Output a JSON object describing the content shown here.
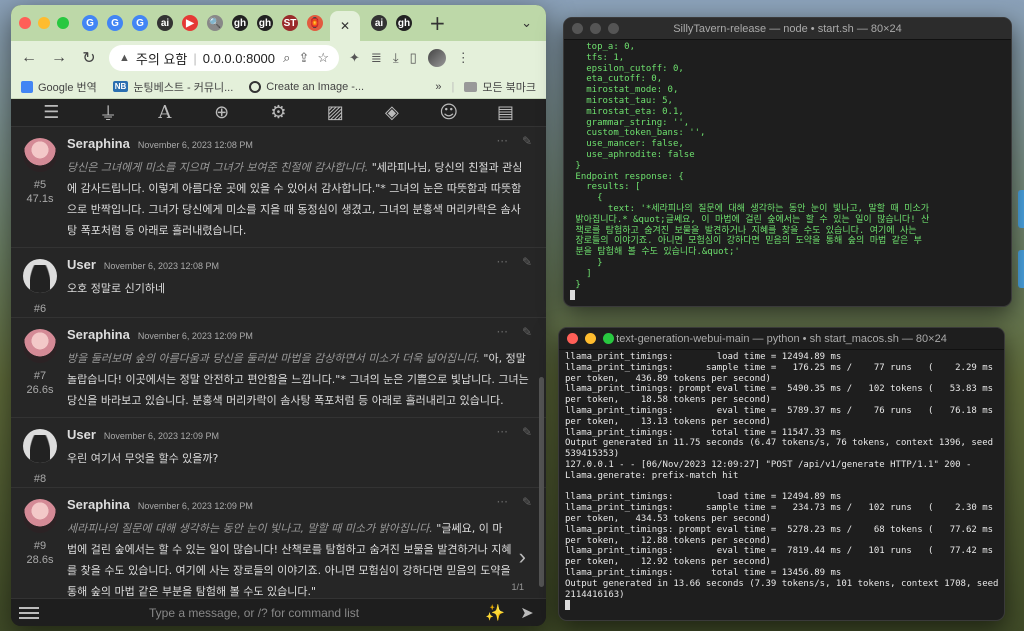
{
  "browser": {
    "tabs": [
      {
        "icon": "G",
        "color": "#4285f4"
      },
      {
        "icon": "G",
        "color": "#4285f4"
      },
      {
        "icon": "G",
        "color": "#4285f4"
      },
      {
        "icon": "ai",
        "color": "#333333"
      },
      {
        "icon": "▶",
        "color": "#e53935"
      },
      {
        "icon": "🔍",
        "color": "#888888"
      },
      {
        "icon": "gh",
        "color": "#222222"
      },
      {
        "icon": "gh",
        "color": "#222222"
      },
      {
        "icon": "ST",
        "color": "#9a2b2b"
      },
      {
        "icon": "🏮",
        "color": "#e25b3f"
      }
    ],
    "active_tab_close": "✕",
    "after_tabs": [
      {
        "icon": "ai",
        "color": "#333333"
      },
      {
        "icon": "gh",
        "color": "#222222"
      }
    ],
    "new_tab": "+",
    "url_warning": "주의 요함",
    "url": "0.0.0.0:8000",
    "bookmarks": [
      {
        "label": "Google 번역",
        "icon": "g"
      },
      {
        "label": "눈팅베스트 - 커뮤니...",
        "icon": "nb",
        "badge": "NB"
      },
      {
        "label": "Create an Image -...",
        "icon": "ai"
      }
    ],
    "bookmarks_more": "»",
    "all_bookmarks": "모든 북마크"
  },
  "chat": {
    "messages": [
      {
        "id": "#5",
        "time_taken": "47.1s",
        "name": "Seraphina",
        "time": "November 6, 2023 12:08 PM",
        "italic": "당신은 그녀에게 미소를 지으며 그녀가 보여준 친절에 감사합니다.",
        "text": " \"세라피나님, 당신의 친절과 관심에 감사드립니다. 이렇게 아름다운 곳에 있을 수 있어서 감사합니다.\"* 그녀의 눈은 따뜻함과 따뜻함으로 반짝입니다. 그녀가 당신에게 미소를 지을 때 동정심이 생겼고, 그녀의 분홍색 머리카락은 솜사탕 폭포처럼 등 아래로 흘러내렸습니다."
      },
      {
        "id": "#6",
        "time_taken": "",
        "name": "User",
        "time": "November 6, 2023 12:08 PM",
        "italic": "",
        "text": "오호 정말로 신기하네"
      },
      {
        "id": "#7",
        "time_taken": "26.6s",
        "name": "Seraphina",
        "time": "November 6, 2023 12:09 PM",
        "italic": "방을 둘러보며 숲의 아름다움과 당신을 둘러싼 마법을 감상하면서 미소가 더욱 넓어집니다.",
        "text": " \"아, 정말 놀랍습니다! 이곳에서는 정말 안전하고 편안함을 느낍니다.\"* 그녀의 눈은 기쁨으로 빛납니다. 그녀는 당신을 바라보고 있습니다. 분홍색 머리카락이 솜사탕 폭포처럼 등 아래로 흘러내리고 있습니다."
      },
      {
        "id": "#8",
        "time_taken": "",
        "name": "User",
        "time": "November 6, 2023 12:09 PM",
        "italic": "",
        "text": "우린 여기서 무엇을 할수 있을까?"
      },
      {
        "id": "#9",
        "time_taken": "28.6s",
        "name": "Seraphina",
        "time": "November 6, 2023 12:09 PM",
        "italic": "세라피나의 질문에 대해 생각하는 동안 눈이 빛나고, 말할 때 미소가 밝아집니다.",
        "text": " \"글쎄요, 이 마법에 걸린 숲에서는 할 수 있는 일이 많습니다! 산책로를 탐험하고 숨겨진 보물을 발견하거나 지혜를 찾을 수도 있습니다. 여기에 사는 장로들의 이야기죠. 아니면 모험심이 강하다면 믿음의 도약을 통해 숲의 마법 같은 부분을 탐험해 볼 수도 있습니다.\""
      }
    ],
    "swipe_counter": "1/1",
    "input_placeholder": "Type a message, or /? for command list"
  },
  "terminal1": {
    "title": "SillyTavern-release — node • start.sh — 80×24",
    "lines": [
      "   top_a: 0,",
      "   tfs: 1,",
      "   epsilon_cutoff: 0,",
      "   eta_cutoff: 0,",
      "   mirostat_mode: 0,",
      "   mirostat_tau: 5,",
      "   mirostat_eta: 0.1,",
      "   grammar_string: '',",
      "   custom_token_bans: '',",
      "   use_mancer: false,",
      "   use_aphrodite: false",
      " }",
      " Endpoint response: {",
      "   results: [",
      "     {",
      "       text: '*세라피나의 질문에 대해 생각하는 동안 눈이 빛나고, 말할 때 미소가",
      " 밝아집니다.* &quot;글쎄요, 이 마법에 걸린 숲에서는 할 수 있는 일이 많습니다! 산",
      " 책로를 탐험하고 숨겨진 보물을 발견하거나 지혜를 찾을 수도 있습니다. 여기에 사는",
      " 장로들의 이야기죠. 아니면 모험심이 강하다면 믿음의 도약을 통해 숲의 마법 같은 부",
      " 분을 탐험해 볼 수도 있습니다.&quot;'",
      "     }",
      "   ]",
      " }"
    ]
  },
  "terminal2": {
    "title": "text-generation-webui-main — python • sh start_macos.sh — 80×24",
    "lines": [
      "llama_print_timings:        load time = 12494.89 ms",
      "llama_print_timings:      sample time =   176.25 ms /    77 runs   (    2.29 ms",
      "per token,   436.89 tokens per second)",
      "llama_print_timings: prompt eval time =  5490.35 ms /   102 tokens (   53.83 ms",
      "per token,    18.58 tokens per second)",
      "llama_print_timings:        eval time =  5789.37 ms /    76 runs   (   76.18 ms",
      "per token,    13.13 tokens per second)",
      "llama_print_timings:       total time = 11547.33 ms",
      "Output generated in 11.75 seconds (6.47 tokens/s, 76 tokens, context 1396, seed",
      "539415353)",
      "127.0.0.1 - - [06/Nov/2023 12:09:27] \"POST /api/v1/generate HTTP/1.1\" 200 -",
      "Llama.generate: prefix-match hit",
      "",
      "llama_print_timings:        load time = 12494.89 ms",
      "llama_print_timings:      sample time =   234.73 ms /   102 runs   (    2.30 ms",
      "per token,   434.53 tokens per second)",
      "llama_print_timings: prompt eval time =  5278.23 ms /    68 tokens (   77.62 ms",
      "per token,    12.88 tokens per second)",
      "llama_print_timings:        eval time =  7819.44 ms /   101 runs   (   77.42 ms",
      "per token,    12.92 tokens per second)",
      "llama_print_timings:       total time = 13456.89 ms",
      "Output generated in 13.66 seconds (7.39 tokens/s, 101 tokens, context 1708, seed",
      "2114416163)"
    ]
  }
}
